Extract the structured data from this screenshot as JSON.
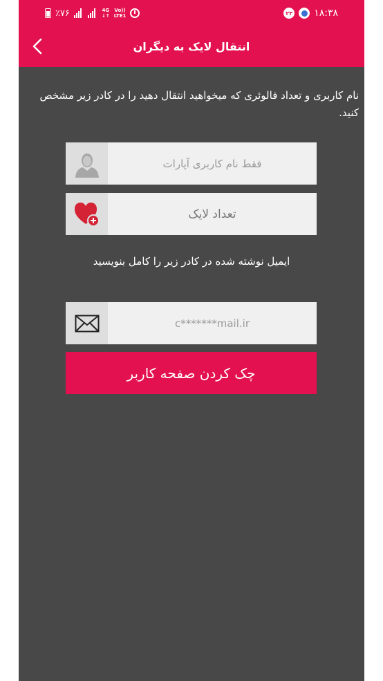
{
  "status_bar": {
    "battery": "٪۷۶",
    "network_top": "4G",
    "network_bottom": "LTE1",
    "volte": "Vo))",
    "time": "۱۸:۳۸",
    "notification_badge": "۲۳"
  },
  "toolbar": {
    "title": "انتقال لایک به دیگران"
  },
  "intro": {
    "text": "نام کاربری و تعداد فالوئری که میخواهید انتقال دهید را در کادر زیر مشخص کنید."
  },
  "form": {
    "username_placeholder": "فقط نام کاربری آپارات",
    "likes_placeholder": "تعداد لایک",
    "email_note": "ایمیل نوشته شده در کادر زیر را کامل بنویسید",
    "email_placeholder": "c*******mail.ir",
    "check_button_label": "چک کردن صفحه کاربر"
  },
  "colors": {
    "primary": "#e3114f",
    "background": "#484848",
    "field_bg": "#f0f0f0",
    "icon_bg": "#dedede"
  }
}
